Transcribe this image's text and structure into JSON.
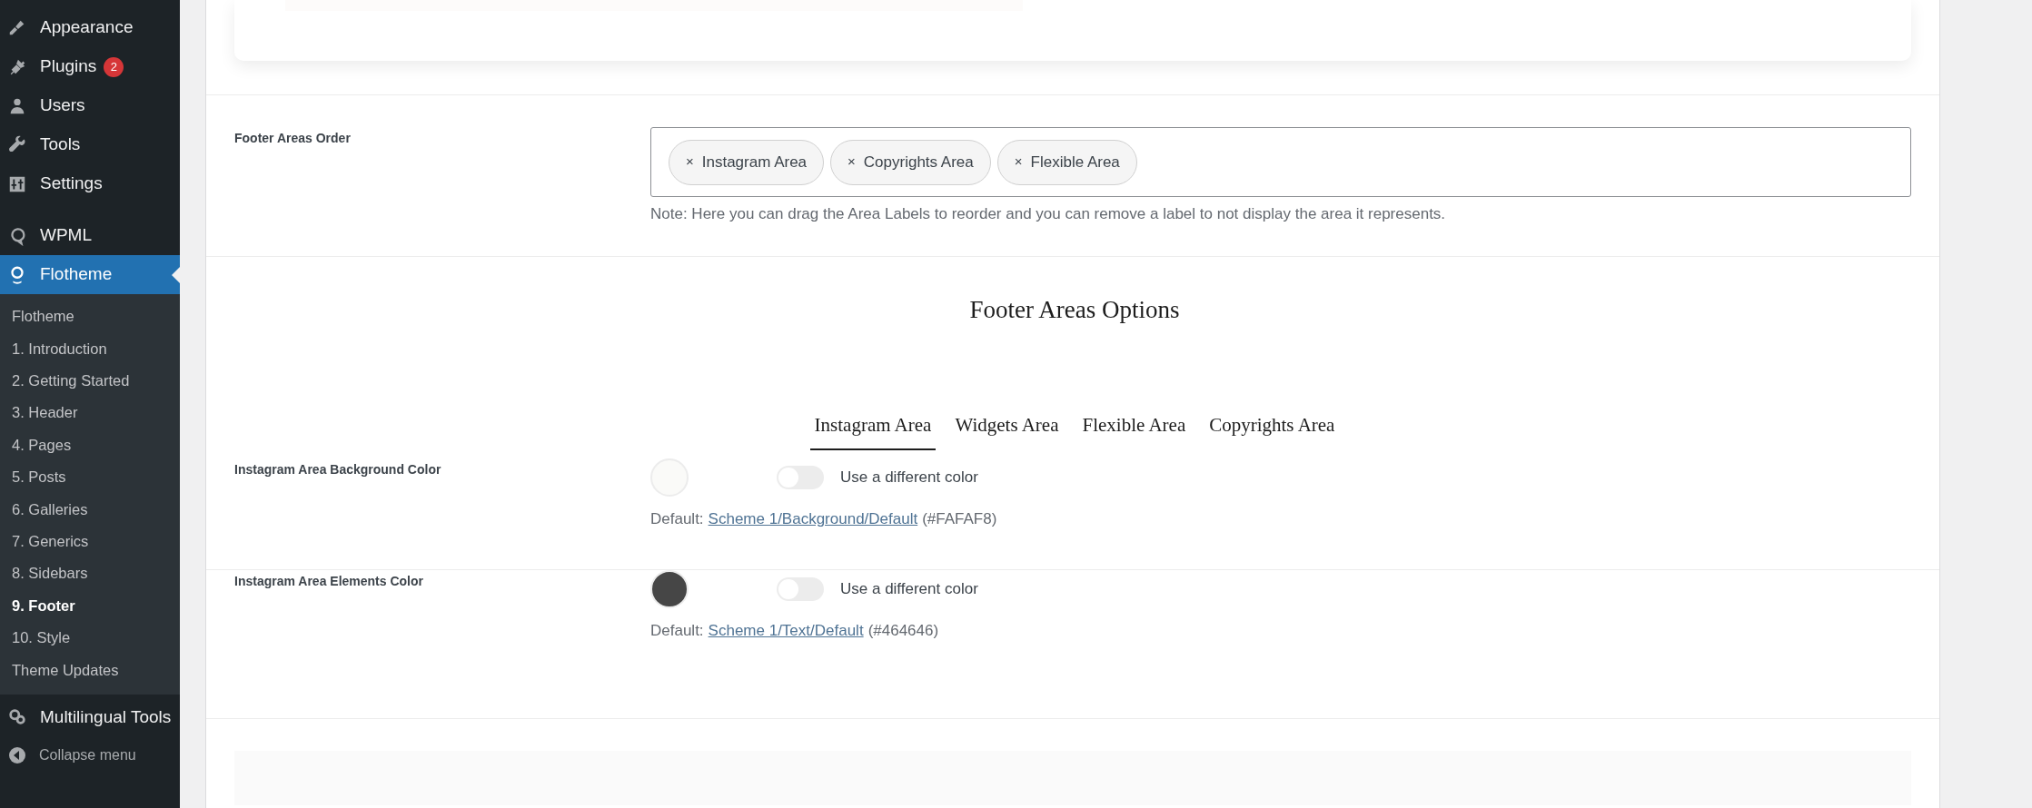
{
  "sidebar": {
    "menu": [
      {
        "label": "Appearance",
        "selected": false
      },
      {
        "label": "Plugins",
        "badge": "2",
        "selected": false
      },
      {
        "label": "Users",
        "selected": false
      },
      {
        "label": "Tools",
        "selected": false
      },
      {
        "label": "Settings",
        "selected": false
      },
      {
        "label": "WPML",
        "selected": false
      },
      {
        "label": "Flotheme",
        "selected": true
      }
    ],
    "submenu": [
      {
        "label": "Flotheme",
        "selected": false
      },
      {
        "label": "1. Introduction",
        "selected": false
      },
      {
        "label": "2. Getting Started",
        "selected": false
      },
      {
        "label": "3. Header",
        "selected": false
      },
      {
        "label": "4. Pages",
        "selected": false
      },
      {
        "label": "5. Posts",
        "selected": false
      },
      {
        "label": "6. Galleries",
        "selected": false
      },
      {
        "label": "7. Generics",
        "selected": false
      },
      {
        "label": "8. Sidebars",
        "selected": false
      },
      {
        "label": "9. Footer",
        "selected": true
      },
      {
        "label": "10. Style",
        "selected": false
      },
      {
        "label": "Theme Updates",
        "selected": false
      }
    ],
    "after": [
      {
        "label": "Multilingual Tools",
        "selected": false
      }
    ],
    "collapse": "Collapse menu"
  },
  "footer_areas_order": {
    "label": "Footer Areas Order",
    "chips": [
      {
        "remove": "×",
        "label": "Instagram Area"
      },
      {
        "remove": "×",
        "label": "Copyrights Area"
      },
      {
        "remove": "×",
        "label": "Flexible Area"
      }
    ],
    "note": "Note: Here you can drag the Area Labels to reorder and you can remove a label to not display the area it represents."
  },
  "options_heading": "Footer Areas Options",
  "tabs": [
    {
      "label": "Instagram Area",
      "selected": true
    },
    {
      "label": "Widgets Area",
      "selected": false
    },
    {
      "label": "Flexible Area",
      "selected": false
    },
    {
      "label": "Copyrights Area",
      "selected": false
    }
  ],
  "color_settings": [
    {
      "label": "Instagram Area Background Color",
      "color": "#fafaf8",
      "on": false,
      "toggle_label": "Use a different color",
      "default_prefix": "Default:",
      "link": "Scheme 1/Background/Default",
      "hex": "(#FAFAF8)"
    },
    {
      "label": "Instagram Area Elements Color",
      "color": "#464646",
      "on": false,
      "toggle_label": "Use a different color",
      "default_prefix": "Default:",
      "link": "Scheme 1/Text/Default",
      "hex": "(#464646)"
    }
  ]
}
